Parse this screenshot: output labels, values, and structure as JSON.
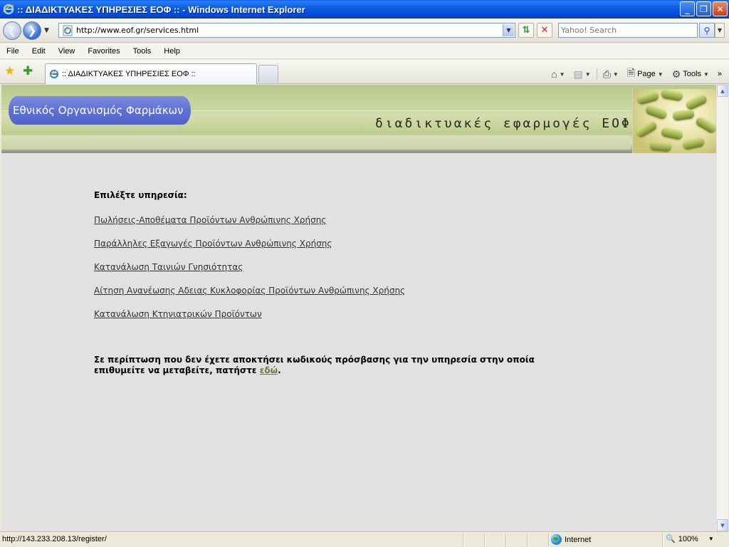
{
  "window": {
    "title": ":: ΔΙΑΔΙΚΤΥΑΚΕΣ ΥΠΗΡΕΣΙΕΣ ΕΟΦ :: - Windows Internet Explorer",
    "minimize": "_",
    "maximize": "❐",
    "close": "✕"
  },
  "address": {
    "url": "http://www.eof.gr/services.html",
    "search_placeholder": "Yahoo! Search"
  },
  "menu": [
    "File",
    "Edit",
    "View",
    "Favorites",
    "Tools",
    "Help"
  ],
  "tab": {
    "label": ":: ΔΙΑΔΙΚΤΥΑΚΕΣ ΥΠΗΡΕΣΙΕΣ ΕΟΦ ::"
  },
  "commandbar": {
    "page": "Page",
    "tools": "Tools"
  },
  "banner": {
    "org_name": "Εθνικός Οργανισμός Φαρμάκων",
    "tagline": "διαδικτυακές εφαρμογές ΕΟΦ"
  },
  "main": {
    "heading": "Επιλέξτε υπηρεσία:",
    "services": [
      "Πωλήσεις-Αποθέματα Προϊόντων Ανθρώπινης Χρήσης",
      "Παράλληλες Εξαγωγές Προϊόντων Ανθρώπινης Χρήσης",
      "Κατανάλωση Ταινιών Γνησιότητας",
      "Αίτηση Ανανέωσης Αδειας Κυκλοφορίας Προϊόντων Ανθρώπινης Χρήσης",
      "Κατανάλωση Κτηνιατρικών Προϊόντων"
    ],
    "note_text": "Σε περίπτωση που δεν έχετε αποκτήσει κωδικούς πρόσβασης για την υπηρεσία στην οποία επιθυμείτε να μεταβείτε, πατήστε ",
    "note_link": "εδώ",
    "note_end": "."
  },
  "status": {
    "url": "http://143.233.208.13/register/",
    "zone": "Internet",
    "zoom": "100%"
  },
  "colors": {
    "titlebar": "#0c5ee6",
    "content_bg": "#e1e1e1",
    "logo_pill": "#5d6fd3",
    "note_link": "#6f7a33"
  }
}
